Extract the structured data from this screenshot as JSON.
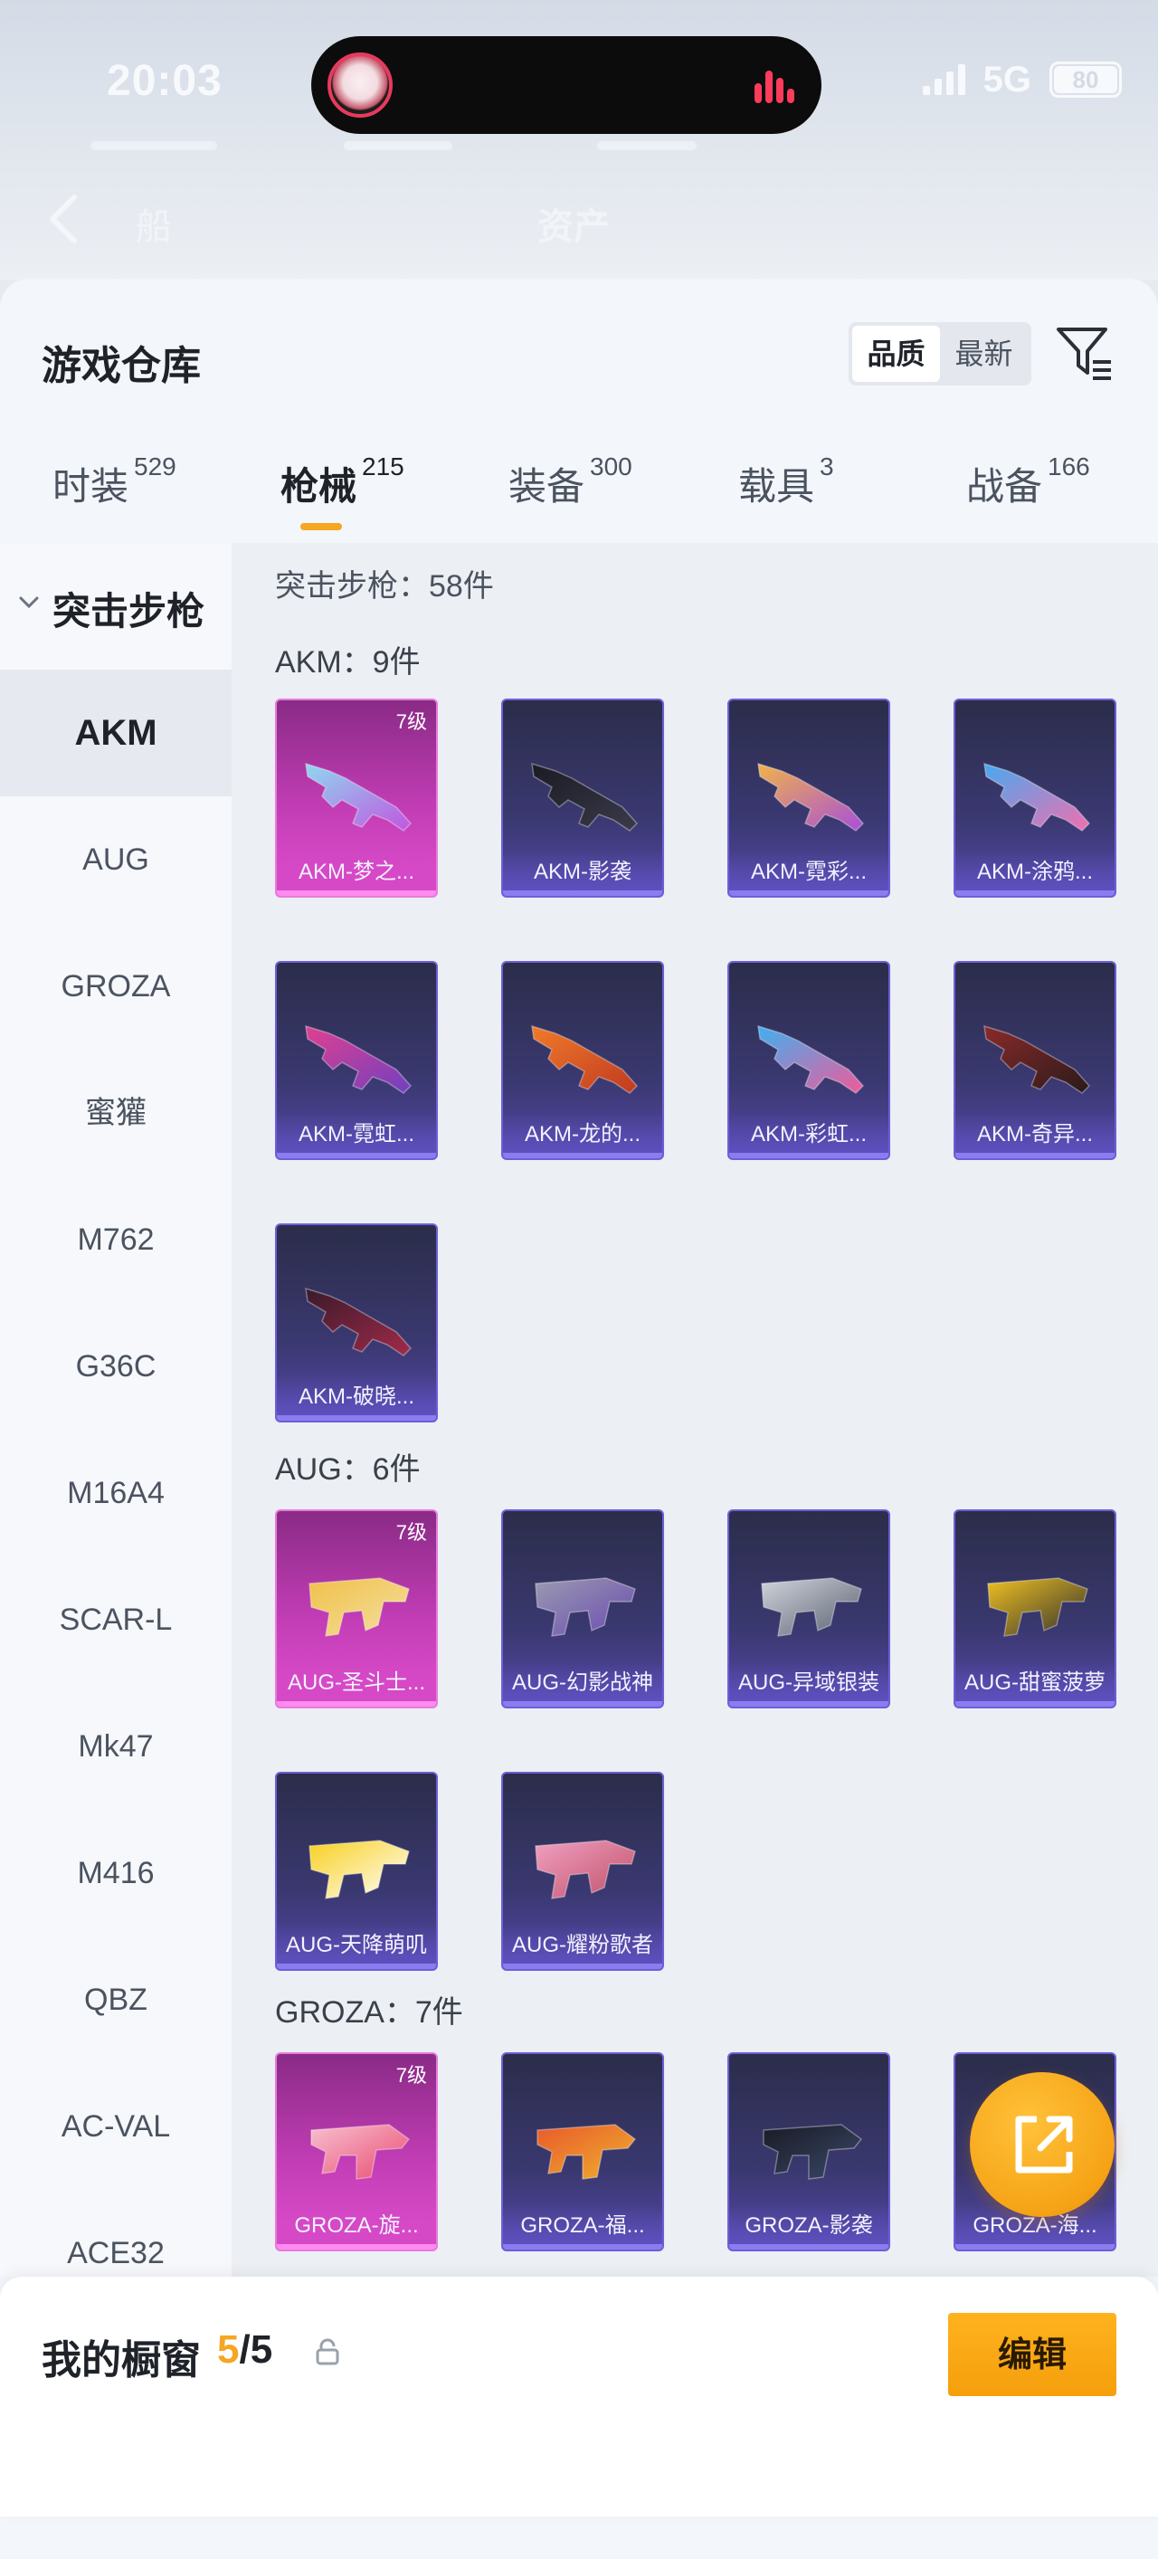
{
  "status_bar": {
    "time": "20:03",
    "network": "5G",
    "battery": "80"
  },
  "header": {
    "tabs": [
      "船",
      "资产"
    ]
  },
  "page": {
    "title": "游戏仓库",
    "sort": {
      "options": [
        "品质",
        "最新"
      ],
      "selected": "品质"
    }
  },
  "tabs": [
    {
      "label": "时装",
      "count": "529"
    },
    {
      "label": "枪械",
      "count": "215",
      "active": true
    },
    {
      "label": "装备",
      "count": "300"
    },
    {
      "label": "载具",
      "count": "3"
    },
    {
      "label": "战备",
      "count": "166"
    }
  ],
  "sidebar": {
    "category": "突击步枪",
    "items": [
      "AKM",
      "AUG",
      "GROZA",
      "蜜獾",
      "M762",
      "G36C",
      "M16A4",
      "SCAR-L",
      "Mk47",
      "M416",
      "QBZ",
      "AC-VAL",
      "ACE32"
    ],
    "selected": "AKM"
  },
  "content": {
    "category_count": "突击步枪：58件",
    "groups": [
      {
        "title": "AKM：9件",
        "items": [
          {
            "name": "AKM-梦之...",
            "level": "7级",
            "quality": "gold",
            "colors": [
              "#8fd8f0",
              "#c056e0"
            ]
          },
          {
            "name": "AKM-影袭",
            "quality": "purple",
            "colors": [
              "#1b1b24",
              "#3a3a4a"
            ]
          },
          {
            "name": "AKM-霓彩...",
            "quality": "purple",
            "colors": [
              "#f0b24a",
              "#a84fd8"
            ]
          },
          {
            "name": "AKM-涂鸦...",
            "quality": "purple",
            "colors": [
              "#48a8f0",
              "#f070b0"
            ]
          },
          {
            "name": "AKM-霓虹...",
            "quality": "purple",
            "colors": [
              "#e04090",
              "#7040c0"
            ]
          },
          {
            "name": "AKM-龙的...",
            "quality": "purple",
            "colors": [
              "#f07a2a",
              "#c03a20"
            ]
          },
          {
            "name": "AKM-彩虹...",
            "quality": "purple",
            "colors": [
              "#40b0f0",
              "#f05a9a"
            ]
          },
          {
            "name": "AKM-奇异...",
            "quality": "purple",
            "colors": [
              "#8a2a2a",
              "#2a1a1a"
            ]
          },
          {
            "name": "AKM-破晓...",
            "quality": "purple",
            "colors": [
              "#3a1a2a",
              "#a02a4a"
            ]
          }
        ]
      },
      {
        "title": "AUG：6件",
        "items": [
          {
            "name": "AUG-圣斗士...",
            "level": "7级",
            "quality": "gold",
            "colors": [
              "#f0c04a",
              "#f4e0a0"
            ]
          },
          {
            "name": "AUG-幻影战神",
            "quality": "purple",
            "colors": [
              "#9a9ab0",
              "#6a4ab0"
            ]
          },
          {
            "name": "AUG-异域银装",
            "quality": "purple",
            "colors": [
              "#d0d4dc",
              "#5a6070"
            ]
          },
          {
            "name": "AUG-甜蜜菠萝",
            "quality": "purple",
            "colors": [
              "#f0c020",
              "#303030"
            ]
          },
          {
            "name": "AUG-天降萌叽",
            "quality": "purple",
            "colors": [
              "#f8d020",
              "#ffffff"
            ]
          },
          {
            "name": "AUG-耀粉歌者",
            "quality": "purple",
            "colors": [
              "#f0a0c0",
              "#c0506a"
            ]
          }
        ]
      },
      {
        "title": "GROZA：7件",
        "items": [
          {
            "name": "GROZA-旋...",
            "level": "7级",
            "quality": "gold",
            "colors": [
              "#f8c0d0",
              "#e84a70"
            ]
          },
          {
            "name": "GROZA-福...",
            "quality": "purple",
            "colors": [
              "#e85a2a",
              "#f0b030"
            ]
          },
          {
            "name": "GROZA-影袭",
            "quality": "purple",
            "colors": [
              "#1a1a24",
              "#3a4a6a"
            ]
          },
          {
            "name": "GROZA-海...",
            "quality": "purple",
            "colors": [
              "#3ab0e0",
              "#2a6a9a"
            ]
          }
        ]
      }
    ]
  },
  "bottom": {
    "showcase_label": "我的橱窗",
    "showcase_current": "5",
    "showcase_total": "/5",
    "edit_label": "编辑"
  }
}
